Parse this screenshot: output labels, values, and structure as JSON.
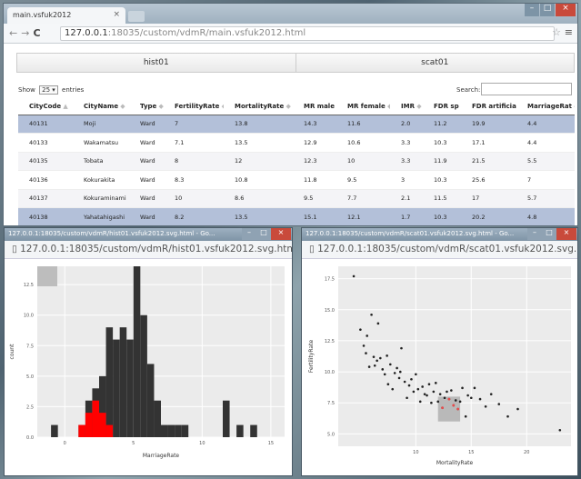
{
  "main_window": {
    "tab_title": "main.vsfuk2012",
    "url_host": "127.0.0.1",
    "url_path": ":18035/custom/vdmR/main.vsfuk2012.html",
    "view_tabs": [
      "hist01",
      "scat01"
    ],
    "show_label": "Show",
    "entries_value": "25",
    "entries_label": "entries",
    "search_label": "Search:"
  },
  "table": {
    "columns": [
      "CityCode",
      "CityName",
      "Type",
      "FertilityRate",
      "MortalityRate",
      "MR male",
      "MR female",
      "IMR",
      "FDR sp",
      "FDR artificial",
      "MarriageRat"
    ],
    "rows": [
      {
        "cells": [
          "40131",
          "Moji",
          "Ward",
          "7",
          "13.8",
          "14.3",
          "11.6",
          "2.0",
          "11.2",
          "19.9",
          "4.4"
        ],
        "highlight": true
      },
      {
        "cells": [
          "40133",
          "Wakamatsu",
          "Ward",
          "7.1",
          "13.5",
          "12.9",
          "10.6",
          "3.3",
          "10.3",
          "17.1",
          "4.4"
        ],
        "highlight": false
      },
      {
        "cells": [
          "40135",
          "Tobata",
          "Ward",
          "8",
          "12",
          "12.3",
          "10",
          "3.3",
          "11.9",
          "21.5",
          "5.5"
        ],
        "highlight": false
      },
      {
        "cells": [
          "40136",
          "Kokurakita",
          "Ward",
          "8.3",
          "10.8",
          "11.8",
          "9.5",
          "3",
          "10.3",
          "25.6",
          "7"
        ],
        "highlight": false
      },
      {
        "cells": [
          "40137",
          "Kokuraminami",
          "Ward",
          "10",
          "8.6",
          "9.5",
          "7.7",
          "2.1",
          "11.5",
          "17",
          "5.7"
        ],
        "highlight": false
      },
      {
        "cells": [
          "40138",
          "Yahatahigashi",
          "Ward",
          "8.2",
          "13.5",
          "15.1",
          "12.1",
          "1.7",
          "10.3",
          "20.2",
          "4.8"
        ],
        "highlight": true
      }
    ]
  },
  "hist_window": {
    "title": "127.0.0.1:18035/custom/vdmR/hist01.vsfuk2012.svg.html - Go...",
    "url_host": "127.0.0.1",
    "url_path": ":18035/custom/vdmR/hist01.vsfuk2012.svg.html"
  },
  "scat_window": {
    "title": "127.0.0.1:18035/custom/vdmR/scat01.vsfuk2012.svg.html - Go...",
    "url_host": "127.0.0.1",
    "url_path": ":18035/custom/vdmR/scat01.vsfuk2012.svg.html"
  },
  "chart_data": [
    {
      "type": "bar",
      "xlabel": "MarriageRate",
      "ylabel": "count",
      "x_ticks": [
        "0",
        "5",
        "10",
        "15"
      ],
      "y_ticks": [
        "0.0",
        "2.5",
        "5.0",
        "7.5",
        "10.0",
        "12.5"
      ],
      "xlim": [
        -2,
        16
      ],
      "ylim": [
        0,
        14
      ],
      "bin_width": 0.5,
      "series": [
        {
          "values": [
            [
              -1,
              1
            ],
            [
              1,
              1
            ],
            [
              1.5,
              3
            ],
            [
              2,
              4
            ],
            [
              2.5,
              5
            ],
            [
              3,
              9
            ],
            [
              3.5,
              8
            ],
            [
              4,
              9
            ],
            [
              4.5,
              8
            ],
            [
              5,
              14
            ],
            [
              5.5,
              10
            ],
            [
              6,
              6
            ],
            [
              6.5,
              3
            ],
            [
              7,
              1
            ],
            [
              7.5,
              1
            ],
            [
              8,
              1
            ],
            [
              8.5,
              1
            ],
            [
              11.5,
              3
            ],
            [
              12.5,
              1
            ],
            [
              13.5,
              1
            ]
          ]
        },
        {
          "values": [
            [
              1,
              1
            ],
            [
              1.5,
              2
            ],
            [
              2,
              3
            ],
            [
              2.5,
              2
            ],
            [
              3,
              1
            ]
          ]
        }
      ],
      "colors": [
        "#333333",
        "#ff0000"
      ]
    },
    {
      "type": "scatter",
      "xlabel": "MortalityRate",
      "ylabel": "FertilityRate",
      "x_ticks": [
        "10",
        "15",
        "20"
      ],
      "y_ticks": [
        "5.0",
        "7.5",
        "10.0",
        "12.5",
        "15.0",
        "17.5"
      ],
      "xlim": [
        3,
        24
      ],
      "ylim": [
        4,
        18.5
      ],
      "selection_box": {
        "x": [
          12,
          14
        ],
        "y": [
          6,
          8
        ]
      },
      "points": [
        [
          4.4,
          17.7
        ],
        [
          5,
          13.4
        ],
        [
          5.3,
          12.1
        ],
        [
          5.5,
          11.5
        ],
        [
          5.6,
          12.9
        ],
        [
          5.8,
          10.4
        ],
        [
          6,
          14.6
        ],
        [
          6.2,
          11.2
        ],
        [
          6.3,
          10.5
        ],
        [
          6.5,
          10.9
        ],
        [
          6.6,
          13.9
        ],
        [
          6.8,
          11.1
        ],
        [
          7,
          10.2
        ],
        [
          7.2,
          9.8
        ],
        [
          7.4,
          11.3
        ],
        [
          7.5,
          9
        ],
        [
          7.7,
          10.6
        ],
        [
          7.9,
          8.6
        ],
        [
          8.1,
          9.9
        ],
        [
          8.3,
          10.3
        ],
        [
          8.5,
          9.5
        ],
        [
          8.6,
          10
        ],
        [
          8.7,
          11.9
        ],
        [
          9,
          9.2
        ],
        [
          9.2,
          7.9
        ],
        [
          9.4,
          8.9
        ],
        [
          9.6,
          9.4
        ],
        [
          9.8,
          8.4
        ],
        [
          10,
          9.8
        ],
        [
          10.2,
          8.6
        ],
        [
          10.4,
          7.6
        ],
        [
          10.6,
          8.8
        ],
        [
          10.8,
          8.2
        ],
        [
          11,
          8.1
        ],
        [
          11.2,
          9
        ],
        [
          11.4,
          7.5
        ],
        [
          11.6,
          8.4
        ],
        [
          11.8,
          9.1
        ],
        [
          12,
          7.6
        ],
        [
          12.2,
          8.2
        ],
        [
          12.4,
          7.1
        ],
        [
          12.6,
          7.9
        ],
        [
          12.8,
          8.4
        ],
        [
          13,
          7.8
        ],
        [
          13.2,
          8.5
        ],
        [
          13.4,
          7.3
        ],
        [
          13.6,
          7.7
        ],
        [
          13.8,
          7
        ],
        [
          14,
          7.6
        ],
        [
          14.2,
          8.7
        ],
        [
          14.5,
          6.4
        ],
        [
          14.7,
          8.1
        ],
        [
          15,
          7.9
        ],
        [
          15.3,
          8.7
        ],
        [
          15.8,
          7.8
        ],
        [
          16.3,
          7.2
        ],
        [
          16.8,
          8.2
        ],
        [
          17.5,
          7.4
        ],
        [
          18.3,
          6.4
        ],
        [
          19.2,
          7
        ],
        [
          23,
          5.3
        ]
      ],
      "selected_points": [
        [
          12.4,
          7.1
        ],
        [
          13,
          7.8
        ],
        [
          13.4,
          7.3
        ],
        [
          13.8,
          7
        ]
      ],
      "colors": [
        "#222222",
        "#e84c4c"
      ]
    }
  ]
}
